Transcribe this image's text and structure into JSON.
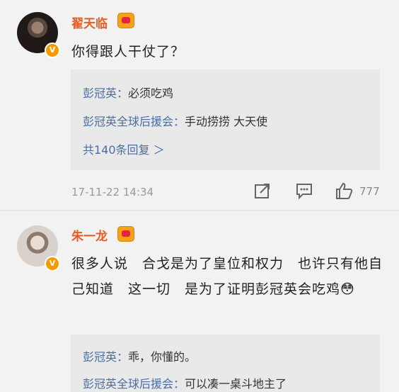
{
  "comments": [
    {
      "user": "翟天临",
      "text": "你得跟人干仗了？",
      "replies": [
        {
          "name": "彭冠英",
          "text": "必须吃鸡"
        },
        {
          "name": "彭冠英全球后援会",
          "text": "手动捞捞 大天使"
        }
      ],
      "more": "共140条回复 ＞",
      "time": "17-11-22 14:34",
      "likes": "777"
    },
    {
      "user": "朱一龙",
      "text": "很多人说　合戈是为了皇位和权力　也许只有他自己知道　这一切　是为了证明彭冠英会吃鸡😳",
      "replies": [
        {
          "name": "彭冠英",
          "text": "乖，你懂的。"
        },
        {
          "name": "彭冠英全球后援会",
          "text": "可以凑一桌斗地主了"
        }
      ]
    }
  ],
  "colors": {
    "name": "#e45e26",
    "link": "#4a6ea3",
    "badge": "#f59a00"
  },
  "icons": [
    "verified-icon",
    "vip-crown-icon",
    "share-icon",
    "comment-icon",
    "like-icon"
  ]
}
